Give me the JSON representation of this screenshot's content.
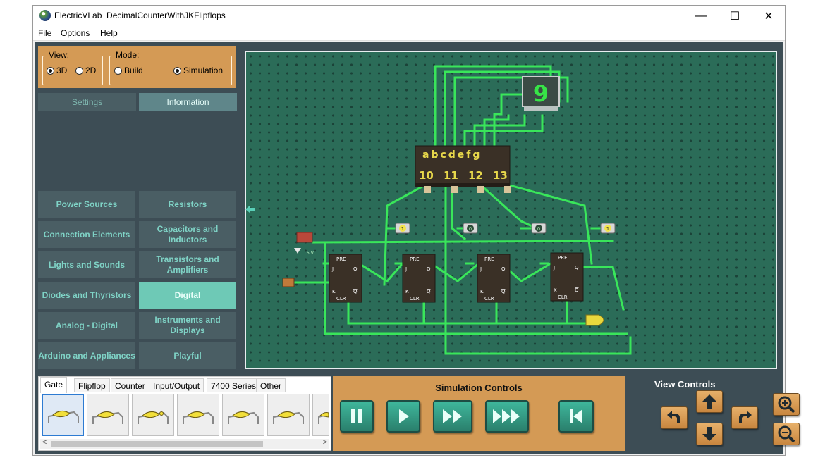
{
  "window": {
    "app_name": "ElectricVLab",
    "document_title": "DecimalCounterWithJKFlipflops",
    "minimize_glyph": "—",
    "maximize_glyph": "☐",
    "close_glyph": "✕"
  },
  "menu": [
    "File",
    "Options",
    "Help"
  ],
  "mode_panel": {
    "view_label": "View:",
    "view_options": [
      {
        "label": "3D",
        "selected": true
      },
      {
        "label": "2D",
        "selected": false
      }
    ],
    "mode_label": "Mode:",
    "mode_options": [
      {
        "label": "Build",
        "selected": false
      },
      {
        "label": "Simulation",
        "selected": true
      }
    ]
  },
  "info_tabs": [
    {
      "label": "Settings",
      "active": false
    },
    {
      "label": "Information",
      "active": true
    }
  ],
  "categories": [
    {
      "label": "Power Sources",
      "active": false
    },
    {
      "label": "Resistors",
      "active": false
    },
    {
      "label": "Connection Elements",
      "active": false
    },
    {
      "label": "Capacitors and Inductors",
      "active": false
    },
    {
      "label": "Lights and Sounds",
      "active": false
    },
    {
      "label": "Transistors and Amplifiers",
      "active": false
    },
    {
      "label": "Diodes and Thyristors",
      "active": false
    },
    {
      "label": "Digital",
      "active": true
    },
    {
      "label": "Analog - Digital",
      "active": false
    },
    {
      "label": "Instruments and Displays",
      "active": false
    },
    {
      "label": "Arduino and Appliances",
      "active": false
    },
    {
      "label": "Playful",
      "active": false
    }
  ],
  "circuit": {
    "decoder_top_labels": "abcdefg",
    "decoder_pins": [
      "10",
      "11",
      "12",
      "13"
    ],
    "display_digit": "9",
    "source_label": "5 V",
    "probe_values": [
      "1",
      "0",
      "0",
      "1"
    ],
    "flipflop_labels": {
      "pre": "PRE",
      "clr": "CLR",
      "j": "J",
      "k": "K",
      "q": "Q",
      "qbar": "Q"
    }
  },
  "palette": {
    "tabs": [
      {
        "label": "Gate",
        "selected": true
      },
      {
        "label": "Flipflop",
        "selected": false
      },
      {
        "label": "Counter",
        "selected": false
      },
      {
        "label": "Input/Output",
        "selected": false
      },
      {
        "label": "7400 Series",
        "selected": false
      },
      {
        "label": "Other",
        "selected": false
      }
    ],
    "left_arrow": "<",
    "right_arrow": ">"
  },
  "simulation": {
    "title": "Simulation Controls",
    "buttons": [
      "pause",
      "play",
      "fast-forward",
      "fastest-forward",
      "restart"
    ]
  },
  "view_controls": {
    "title": "View Controls"
  },
  "colors": {
    "panel_orange": "#d49a55",
    "panel_dark": "#3d4d55",
    "board_green": "#2b6c58",
    "wire_green": "#39e65a",
    "button_teal": "#3fb79c",
    "category_text": "#7fd3c6",
    "category_active": "#6ec9b6"
  }
}
